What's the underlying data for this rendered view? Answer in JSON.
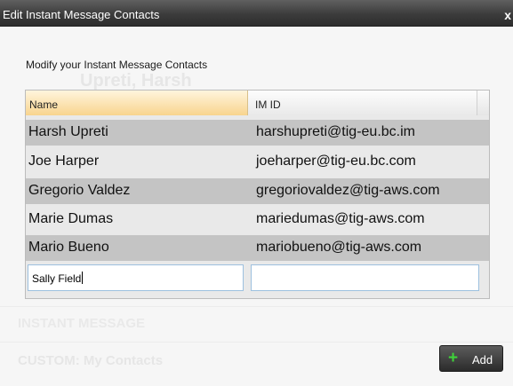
{
  "dialog": {
    "title": "Edit Instant Message Contacts",
    "close_label": "x",
    "prompt": "Modify your Instant Message Contacts"
  },
  "background": {
    "name_ghost": "Upreti, Harsh",
    "section_instant": "INSTANT MESSAGE",
    "section_custom": "CUSTOM: My Contacts"
  },
  "grid": {
    "headers": {
      "name": "Name",
      "imid": "IM ID"
    },
    "rows": [
      {
        "name": "Harsh Upreti",
        "imid": "harshupreti@tig-eu.bc.im"
      },
      {
        "name": "Joe Harper",
        "imid": "joeharper@tig-eu.bc.com"
      },
      {
        "name": "Gregorio Valdez",
        "imid": "gregoriovaldez@tig-aws.com"
      },
      {
        "name": "Marie Dumas",
        "imid": "mariedumas@tig-aws.com"
      },
      {
        "name": "Mario Bueno",
        "imid": "mariobueno@tig-aws.com"
      }
    ],
    "new_row": {
      "name_value": "Sally Field",
      "imid_value": ""
    }
  },
  "buttons": {
    "add_label": "Add",
    "add_icon": "plus-icon"
  },
  "colors": {
    "header_sort": "#f8d48e",
    "row_dark": "#c4c4c4",
    "add_plus": "#3fd23a"
  }
}
